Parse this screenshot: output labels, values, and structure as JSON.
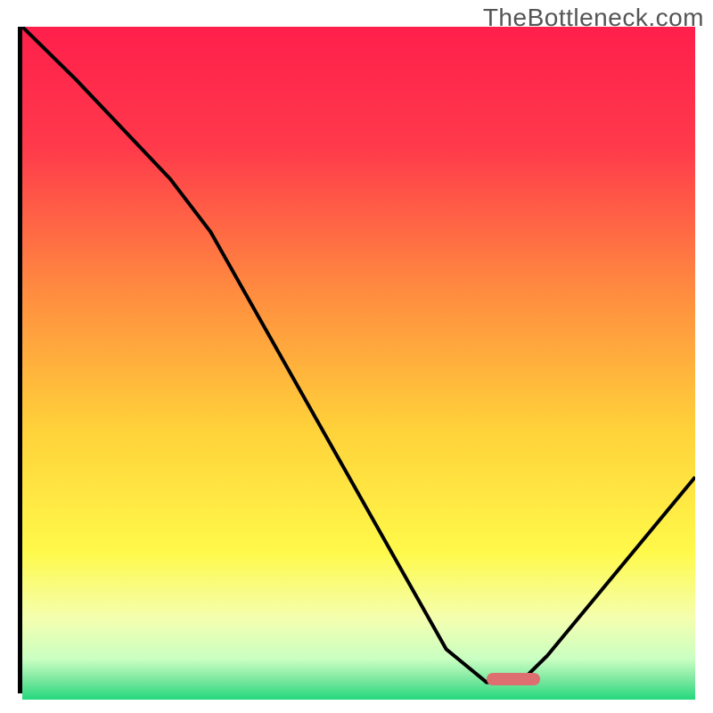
{
  "watermark": "TheBottleneck.com",
  "chart_data": {
    "type": "line",
    "title": "",
    "xlabel": "",
    "ylabel": "",
    "xlim": [
      0,
      100
    ],
    "ylim": [
      0,
      100
    ],
    "grid": false,
    "series": [
      {
        "name": "bottleneck-curve",
        "x": [
          0,
          8,
          22,
          28,
          63,
          69,
          74,
          78,
          100
        ],
        "values": [
          100,
          92,
          77,
          69,
          6,
          1,
          1,
          5,
          32
        ]
      }
    ],
    "marker": {
      "name": "optimal-range",
      "x_start": 69,
      "x_end": 77,
      "y": 1.5,
      "color": "#dd6f70"
    },
    "background_gradient_stops": [
      {
        "pct": 0,
        "color": "#ff1f4b"
      },
      {
        "pct": 18,
        "color": "#ff3a4b"
      },
      {
        "pct": 40,
        "color": "#ff8e3f"
      },
      {
        "pct": 60,
        "color": "#ffd23a"
      },
      {
        "pct": 78,
        "color": "#fff94a"
      },
      {
        "pct": 88,
        "color": "#f4ffb0"
      },
      {
        "pct": 94,
        "color": "#c9ffc2"
      },
      {
        "pct": 97,
        "color": "#7de8a0"
      },
      {
        "pct": 100,
        "color": "#23d87c"
      }
    ]
  }
}
